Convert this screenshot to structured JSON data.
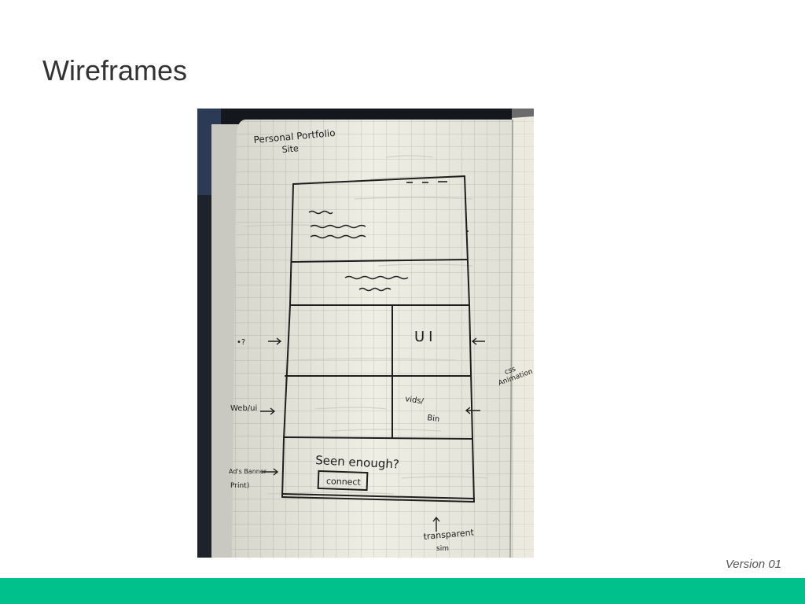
{
  "slide": {
    "title": "Wireframes",
    "version": "Version 01",
    "accent_color": "#00c08b"
  },
  "sketch": {
    "heading": [
      "Personal Portfolio",
      "Site"
    ],
    "section_label": "UI",
    "note_css": [
      "css",
      "Animation"
    ],
    "note_left_top": "•?",
    "note_web": "Web/ui",
    "note_vids": [
      "vids/",
      "Bin"
    ],
    "cta_text": "Seen enough?",
    "cta_button": "connect",
    "note_ads": [
      "Ad's Banner",
      "Print)"
    ],
    "note_bottom": [
      "transparent",
      "sim"
    ]
  }
}
